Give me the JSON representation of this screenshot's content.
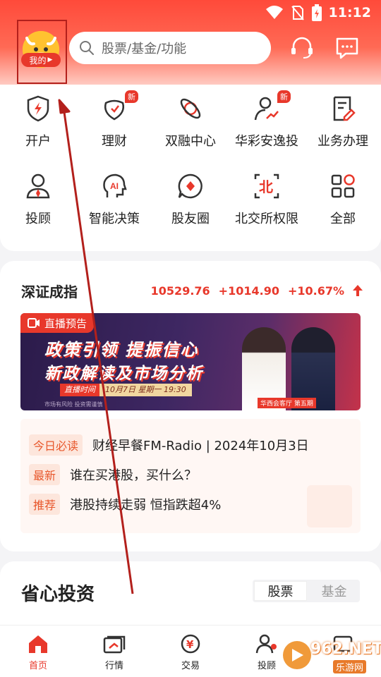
{
  "status_bar": {
    "time": "11:12"
  },
  "header": {
    "avatar_label": "我的",
    "search_placeholder": "股票/基金/功能"
  },
  "quick_menu": [
    {
      "label": "开户",
      "icon": "shield-icon",
      "badge": ""
    },
    {
      "label": "理财",
      "icon": "wallet-icon",
      "badge": "新"
    },
    {
      "label": "双融中心",
      "icon": "planet-icon",
      "badge": ""
    },
    {
      "label": "华彩安逸投",
      "icon": "person-chart-icon",
      "badge": "新"
    },
    {
      "label": "业务办理",
      "icon": "document-edit-icon",
      "badge": ""
    },
    {
      "label": "投顾",
      "icon": "advisor-icon",
      "badge": ""
    },
    {
      "label": "智能决策",
      "icon": "ai-head-icon",
      "badge": ""
    },
    {
      "label": "股友圈",
      "icon": "chat-diamond-icon",
      "badge": ""
    },
    {
      "label": "北交所权限",
      "icon": "bse-icon",
      "badge": ""
    },
    {
      "label": "全部",
      "icon": "grid-icon",
      "badge": ""
    }
  ],
  "index": {
    "name": "深证成指",
    "value": "10529.76",
    "change": "+1014.90",
    "percent": "+10.67%"
  },
  "banner": {
    "live_tag": "直播预告",
    "line1": "政策引领 提振信心",
    "line2": "新政解读及市场分析",
    "time_label": "直播时间",
    "time_value": "10月7日 星期一 19:30",
    "risk_note": "市场有风险 投资需谨慎",
    "episode": "华西会客厅 第五期"
  },
  "news": [
    {
      "tag": "今日必读",
      "text": "财经早餐FM-Radio | 2024年10月3日"
    },
    {
      "tag": "最新",
      "text": "谁在买港股，买什么？"
    },
    {
      "tag": "推荐",
      "text": "港股持续走弱 恒指跌超4%"
    }
  ],
  "invest": {
    "title": "省心投资",
    "tabs": [
      "股票",
      "基金"
    ]
  },
  "tabbar": [
    {
      "label": "首页",
      "icon": "home-icon"
    },
    {
      "label": "行情",
      "icon": "market-icon"
    },
    {
      "label": "交易",
      "icon": "trade-icon"
    },
    {
      "label": "投顾",
      "icon": "advisor-tab-icon"
    },
    {
      "label": "",
      "icon": "more-icon"
    }
  ],
  "watermark": {
    "brand": "962.NET",
    "sub": "乐游网"
  },
  "colors": {
    "accent": "#e8382b",
    "header": "#ff4a3a"
  }
}
